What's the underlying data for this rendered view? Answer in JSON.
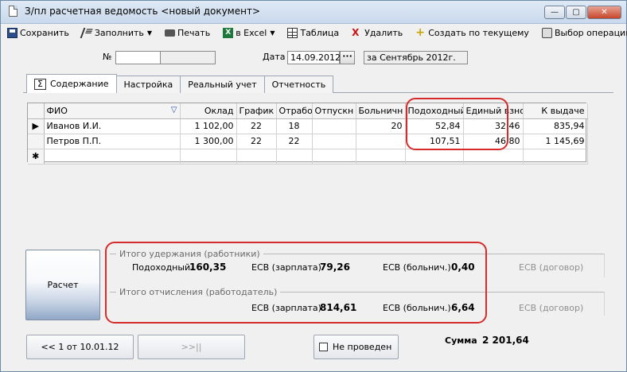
{
  "window": {
    "title": "З/пл расчетная ведомость <новый документ>",
    "controls": {
      "minimize": "—",
      "maximize": "▢",
      "close": "✕"
    }
  },
  "toolbar": {
    "save": "Сохранить",
    "fill": "Заполнить",
    "print": "Печать",
    "excel": "в Excel",
    "table": "Таблица",
    "delete": "Удалить",
    "create_from_current": "Создать по текущему",
    "choose_operation": "Выбор операции",
    "icons": {
      "save": "save-icon",
      "fill": "fill-icon",
      "print": "printer-icon",
      "excel": "excel-icon",
      "table": "table-icon",
      "delete": "delete-icon",
      "create": "plus-icon",
      "choose": "operation-icon"
    }
  },
  "header": {
    "number_label": "№",
    "number_value": "",
    "date_label": "Дата",
    "date_value": "14.09.2012",
    "date_button": "···",
    "period_value": "за Сентябрь 2012г."
  },
  "tabs": [
    {
      "label": "Содержание",
      "active": true
    },
    {
      "label": "Настройка",
      "active": false
    },
    {
      "label": "Реальный учет",
      "active": false
    },
    {
      "label": "Отчетность",
      "active": false
    }
  ],
  "grid": {
    "columns": [
      "ФИО",
      "Оклад",
      "График",
      "Отрабо",
      "Отпускн",
      "Больничн",
      "Подоходный",
      "Единый взно",
      "К выдаче"
    ],
    "rows": [
      {
        "marker": "▶",
        "cells": [
          "Иванов И.И.",
          "1 102,00",
          "22",
          "18",
          "",
          "20",
          "52,84",
          "32,46",
          "835,94"
        ]
      },
      {
        "marker": "",
        "cells": [
          "Петров П.П.",
          "1 300,00",
          "22",
          "22",
          "",
          "",
          "107,51",
          "46,80",
          "1 145,69"
        ]
      }
    ],
    "new_row_marker": "✱"
  },
  "summary": {
    "calc_button": "Расчет",
    "withholdings": {
      "title": "Итого удержания (работники)",
      "income_label": "Подоходный",
      "income_value": "160,35",
      "esv_salary_label": "ЕСВ (зарплата)",
      "esv_salary_value": "79,26",
      "esv_sick_label": "ЕСВ (больнич.)",
      "esv_sick_value": "0,40",
      "esv_contract_label": "ЕСВ (договор)"
    },
    "contributions": {
      "title": "Итого отчисления (работодатель)",
      "esv_salary_label": "ЕСВ (зарплата)",
      "esv_salary_value": "814,61",
      "esv_sick_label": "ЕСВ (больнич.)",
      "esv_sick_value": "6,64",
      "esv_contract_label": "ЕСВ (договор)"
    }
  },
  "footer": {
    "prev_button": "<< 1 от 10.01.12",
    "next_button": ">>||",
    "status_checkbox": "Не проведен",
    "total_label": "Сумма",
    "total_value": "2 201,64"
  },
  "colors": {
    "annotation": "#d62b2b",
    "filter_icon": "#2a4fa5"
  }
}
